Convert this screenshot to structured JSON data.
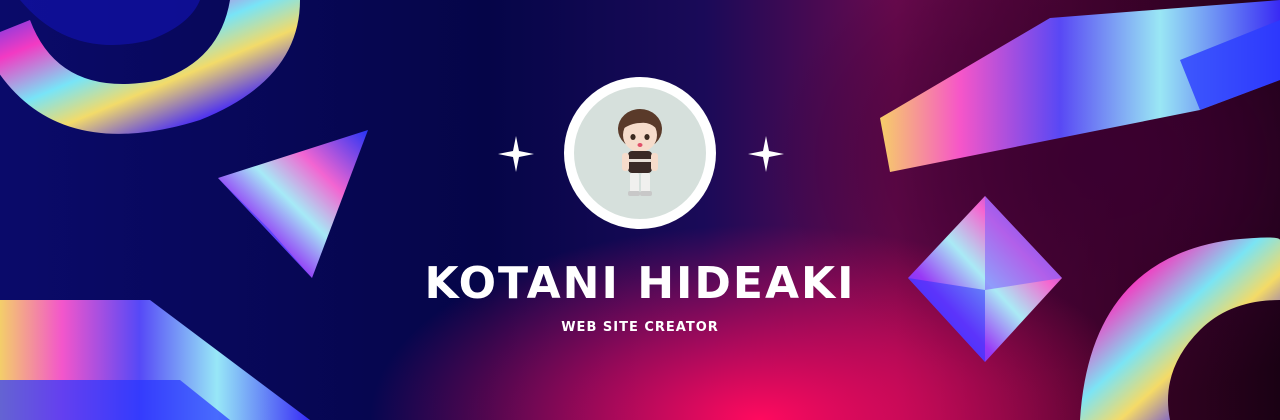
{
  "header": {
    "name": "KOTANI HIDEAKI",
    "tagline": "WEB SITE CREATOR"
  },
  "colors": {
    "background_left": "#0a0a6a",
    "background_center": "#050548",
    "glow_pink": "#ff0a5e",
    "background_right": "#3a0226",
    "text": "#ffffff",
    "avatar_ring": "#ffffff",
    "avatar_bg": "#d6e0dc"
  },
  "icons": {
    "left_sparkle": "sparkle-icon",
    "right_sparkle": "sparkle-icon"
  }
}
